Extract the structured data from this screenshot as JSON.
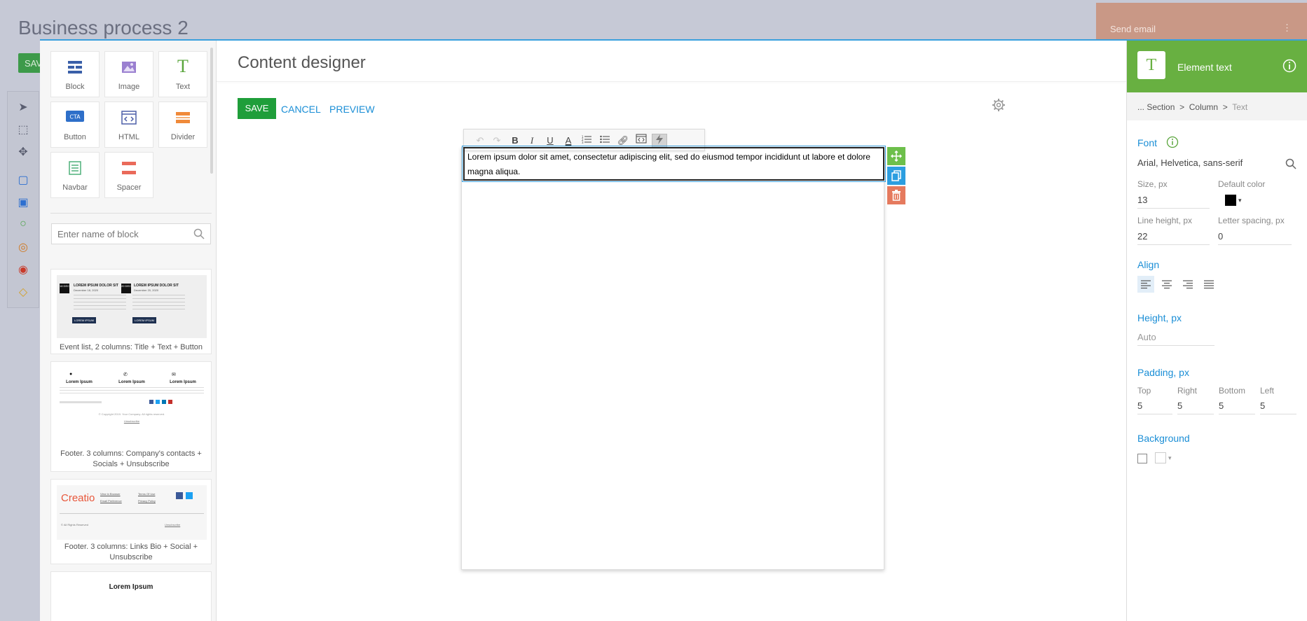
{
  "background": {
    "title": "Business process 2",
    "save_label": "SAV",
    "send_email": "Send email",
    "dots": "⋮"
  },
  "left_panel": {
    "tiles": [
      {
        "label": "Block",
        "icon": "block-icon"
      },
      {
        "label": "Image",
        "icon": "image-icon"
      },
      {
        "label": "Text",
        "icon": "text-icon"
      },
      {
        "label": "Button",
        "icon": "button-icon"
      },
      {
        "label": "HTML",
        "icon": "html-icon"
      },
      {
        "label": "Divider",
        "icon": "divider-icon"
      },
      {
        "label": "Navbar",
        "icon": "navbar-icon"
      },
      {
        "label": "Spacer",
        "icon": "spacer-icon"
      }
    ],
    "search_placeholder": "Enter name of block",
    "cards": [
      {
        "caption": "Event list, 2 columns: Title + Text + Button",
        "preview": {
          "dates": [
            "18 DEC",
            "20 DEC"
          ],
          "headings": [
            "LOREM IPSUM DOLOR SIT",
            "LOREM IPSUM DOLOR SIT"
          ],
          "dates_full": [
            "December 18, 2020",
            "December 20, 2020"
          ],
          "button": "LOREM IPSUM"
        }
      },
      {
        "caption": "Footer. 3 columns: Company's contacts + Socials + Unsubscribe",
        "preview": {
          "heading": "Lorem Ipsum",
          "unsubscribe": "Unsubscribe",
          "copyright": "© Copyright 2019. Your Company. All rights reserved."
        }
      },
      {
        "caption": "Footer. 3 columns: Links Bio + Social + Unsubscribe",
        "preview": {
          "logo": "Creatio",
          "links": [
            "View in Browser",
            "Terms Of Use",
            "Email Preference",
            "Privacy Policy"
          ],
          "reserved": "© All Rights Reserved",
          "unsubscribe": "Unsubscribe"
        }
      },
      {
        "caption": "",
        "preview": {
          "heading": "Lorem Ipsum"
        }
      }
    ]
  },
  "main": {
    "title": "Content designer",
    "save": "SAVE",
    "cancel": "CANCEL",
    "preview": "PREVIEW",
    "text": "Lorem ipsum dolor sit amet, consectetur adipiscing elit, sed do eiusmod tempor incididunt ut labore et dolore magna aliqua."
  },
  "right_panel": {
    "header_title": "Element text",
    "badge": "T",
    "breadcrumb": {
      "prefix": "...",
      "items": [
        "Section",
        "Column",
        "Text"
      ],
      "separator": ">"
    },
    "font": {
      "label": "Font",
      "value": "Arial, Helvetica, sans-serif",
      "size_label": "Size, px",
      "size": "13",
      "default_color_label": "Default color",
      "default_color": "#000000",
      "line_height_label": "Line height, px",
      "line_height": "22",
      "letter_spacing_label": "Letter spacing, px",
      "letter_spacing": "0"
    },
    "align_label": "Align",
    "height": {
      "label": "Height, px",
      "placeholder": "Auto"
    },
    "padding": {
      "label": "Padding, px",
      "top_label": "Top",
      "top": "5",
      "right_label": "Right",
      "right": "5",
      "bottom_label": "Bottom",
      "bottom": "5",
      "left_label": "Left",
      "left": "5"
    },
    "background_label": "Background"
  },
  "colors": {
    "accent_green": "#68b041",
    "save_green": "#1f9e3a",
    "link_blue": "#1a8ed6",
    "move_green": "#6dbf4b",
    "copy_blue": "#2c9ee0",
    "delete_red": "#e57a5e"
  }
}
